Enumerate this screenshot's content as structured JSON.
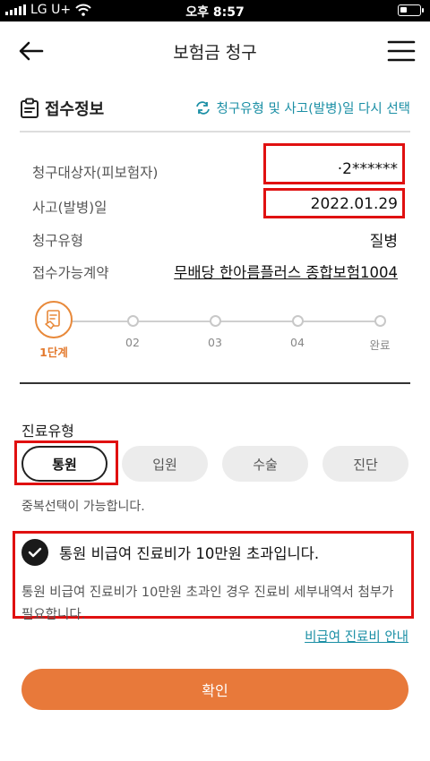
{
  "status_bar": {
    "carrier": "LG U+",
    "time": "오후 8:57"
  },
  "header": {
    "title": "보험금 청구"
  },
  "section": {
    "title": "접수정보",
    "reselect_label": "청구유형 및 사고(발병)일 다시 선택"
  },
  "info": {
    "claimant_label": "청구대상자(피보험자)",
    "claimant_value": "·2******",
    "date_label": "사고(발병)일",
    "date_value": "2022.01.29",
    "type_label": "청구유형",
    "type_value": "질병",
    "contract_label": "접수가능계약",
    "contract_value": "무배당 한아름플러스 종합보험1004"
  },
  "steps": [
    "1단계",
    "02",
    "03",
    "04",
    "완료"
  ],
  "treatment": {
    "label": "진료유형",
    "options": [
      "통원",
      "입원",
      "수술",
      "진단"
    ],
    "selected": "통원",
    "note": "중복선택이 가능합니다."
  },
  "notice": {
    "title": "통원 비급여 진료비가 10만원 초과입니다.",
    "body": "통원 비급여 진료비가 10만원 초과인 경우 진료비 세부내역서 첨부가 필요합니다."
  },
  "guide_link": "비급여 진료비 안내",
  "confirm_label": "확인",
  "colors": {
    "accent": "#e8793a",
    "link": "#1b8fa5",
    "highlight_box": "#e01010"
  }
}
